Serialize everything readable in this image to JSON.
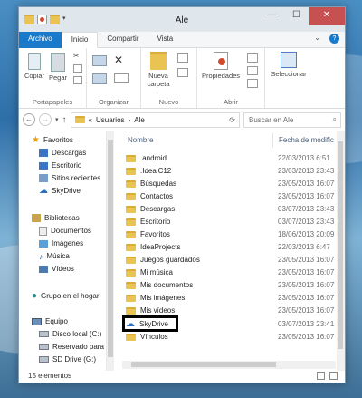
{
  "window": {
    "title": "Ale",
    "minimize": "—",
    "maximize": "☐",
    "close": "✕"
  },
  "tabs": [
    {
      "label": "Archivo"
    },
    {
      "label": "Inicio"
    },
    {
      "label": "Compartir"
    },
    {
      "label": "Vista"
    }
  ],
  "ribbon": {
    "copiar": "Copiar",
    "pegar": "Pegar",
    "portapapeles": "Portapapeles",
    "organizar": "Organizar",
    "nueva_carpeta_1": "Nueva",
    "nueva_carpeta_2": "carpeta",
    "nuevo": "Nuevo",
    "propiedades": "Propiedades",
    "abrir": "Abrir",
    "seleccionar": "Seleccionar"
  },
  "address": {
    "sep": "«",
    "crumb1": "Usuarios",
    "arrow": "›",
    "crumb2": "Ale",
    "search_placeholder": "Buscar en Ale"
  },
  "nav": {
    "favoritos": "Favoritos",
    "descargas": "Descargas",
    "escritorio": "Escritorio",
    "sitios": "Sitios recientes",
    "skydrive": "SkyDrive",
    "bibliotecas": "Bibliotecas",
    "documentos": "Documentos",
    "imagenes": "Imágenes",
    "musica": "Música",
    "videos": "Vídeos",
    "grupo": "Grupo en el hogar",
    "equipo": "Equipo",
    "disco": "Disco local (C:)",
    "reservado": "Reservado para e",
    "sd": "SD Drive (G:)"
  },
  "columns": {
    "name": "Nombre",
    "date": "Fecha de modific"
  },
  "files": [
    {
      "name": ".android",
      "date": "22/03/2013 6:51"
    },
    {
      "name": ".IdealC12",
      "date": "23/03/2013 23:43"
    },
    {
      "name": "Búsquedas",
      "date": "23/05/2013 16:07"
    },
    {
      "name": "Contactos",
      "date": "23/05/2013 16:07"
    },
    {
      "name": "Descargas",
      "date": "03/07/2013 23:43"
    },
    {
      "name": "Escritorio",
      "date": "03/07/2013 23:43"
    },
    {
      "name": "Favoritos",
      "date": "18/06/2013 20:09"
    },
    {
      "name": "IdeaProjects",
      "date": "22/03/2013 6:47"
    },
    {
      "name": "Juegos guardados",
      "date": "23/05/2013 16:07"
    },
    {
      "name": "Mi música",
      "date": "23/05/2013 16:07"
    },
    {
      "name": "Mis documentos",
      "date": "23/05/2013 16:07"
    },
    {
      "name": "Mis imágenes",
      "date": "23/05/2013 16:07"
    },
    {
      "name": "Mis vídeos",
      "date": "23/05/2013 16:07"
    },
    {
      "name": "SkyDrive",
      "date": "03/07/2013 23:41"
    },
    {
      "name": "Vínculos",
      "date": "23/05/2013 16:07"
    }
  ],
  "status": {
    "count": "15 elementos"
  },
  "colors": {
    "file_tab": "#1979ca",
    "folder": "#eac452",
    "close": "#c75050"
  }
}
